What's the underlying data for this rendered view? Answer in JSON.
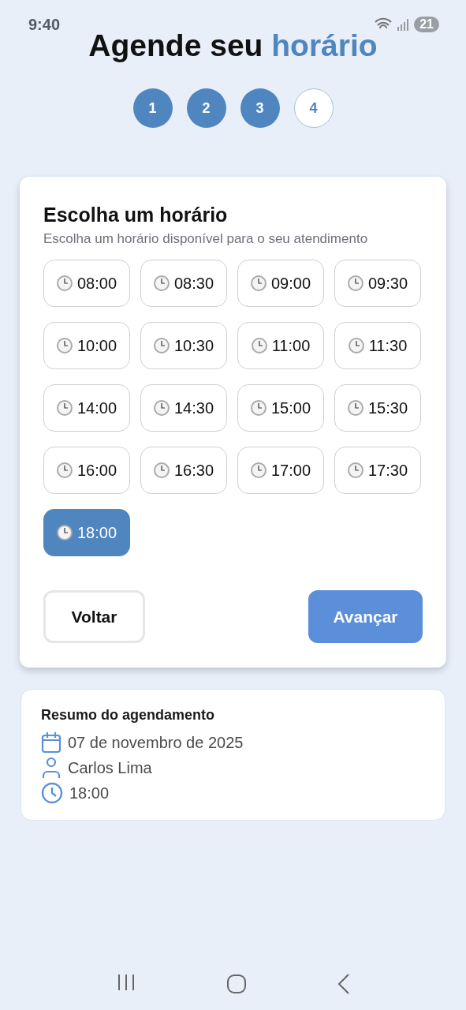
{
  "status_bar": {
    "time": "9:40",
    "battery": "21"
  },
  "title": {
    "start": "Agende seu",
    "highlight": "horário"
  },
  "steps": [
    {
      "label": "1",
      "completed": true
    },
    {
      "label": "2",
      "completed": true
    },
    {
      "label": "3",
      "completed": true
    },
    {
      "label": "4",
      "completed": false
    }
  ],
  "card": {
    "heading": "Escolha um horário",
    "subtitle": "Escolha um horário disponível para o seu atendimento",
    "slots": [
      {
        "label": "08:00",
        "selected": false
      },
      {
        "label": "08:30",
        "selected": false
      },
      {
        "label": "09:00",
        "selected": false
      },
      {
        "label": "09:30",
        "selected": false
      },
      {
        "label": "10:00",
        "selected": false
      },
      {
        "label": "10:30",
        "selected": false
      },
      {
        "label": "11:00",
        "selected": false
      },
      {
        "label": "11:30",
        "selected": false
      },
      {
        "label": "14:00",
        "selected": false
      },
      {
        "label": "14:30",
        "selected": false
      },
      {
        "label": "15:00",
        "selected": false
      },
      {
        "label": "15:30",
        "selected": false
      },
      {
        "label": "16:00",
        "selected": false
      },
      {
        "label": "16:30",
        "selected": false
      },
      {
        "label": "17:00",
        "selected": false
      },
      {
        "label": "17:30",
        "selected": false
      },
      {
        "label": "18:00",
        "selected": true
      }
    ],
    "back_button": "Voltar",
    "next_button": "Avançar"
  },
  "summary": {
    "title": "Resumo do agendamento",
    "items": [
      {
        "kind": "date",
        "text": "07 de novembro de 2025"
      },
      {
        "kind": "person",
        "text": "Carlos Lima"
      },
      {
        "kind": "time",
        "text": "18:00"
      }
    ]
  }
}
